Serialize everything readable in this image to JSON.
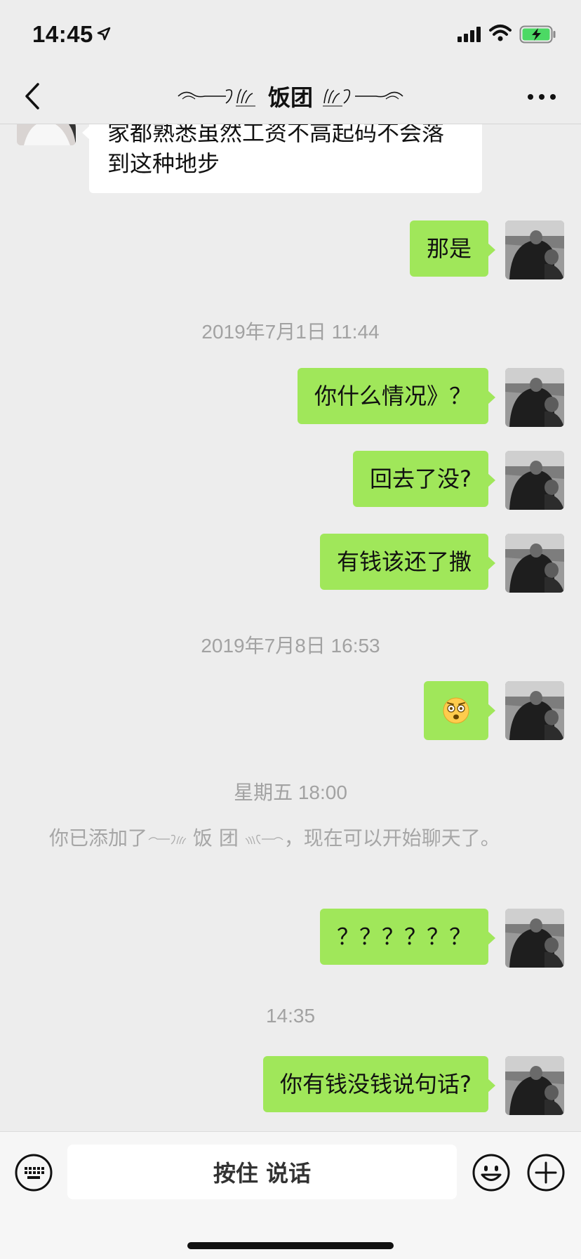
{
  "status_bar": {
    "time": "14:45",
    "icons": [
      "location-arrow-icon",
      "signal-icon",
      "wifi-icon",
      "battery-charging-icon"
    ]
  },
  "nav": {
    "title": "饭团",
    "icons": [
      "back-icon",
      "more-icon"
    ]
  },
  "messages": {
    "m1": "家都熟悉虽然工资不高起码不会落到这种地步",
    "m2": "那是",
    "m3": "你什么情况》？",
    "m4": "回去了没?",
    "m5": "有钱该还了撒",
    "m6_emoji": "dizzy-face-emoji",
    "m7": "？？？？？？",
    "m8": "你有钱没钱说句话?"
  },
  "timestamps": {
    "t1": "2019年7月1日 11:44",
    "t2": "2019年7月8日 16:53",
    "t3": "星期五 18:00",
    "t4": "14:35"
  },
  "system": {
    "prefix": "你已添加了",
    "name": "饭 团",
    "suffix": "，现在可以开始聊天了。"
  },
  "input_bar": {
    "hold_to_talk": "按住 说话",
    "icons": [
      "voice-keyboard-icon",
      "emoji-icon",
      "plus-icon"
    ]
  },
  "colors": {
    "background": "#ededed",
    "outgoing_bubble": "#a0e75a",
    "incoming_bubble": "#ffffff",
    "timestamp_text": "#a2a2a2"
  }
}
